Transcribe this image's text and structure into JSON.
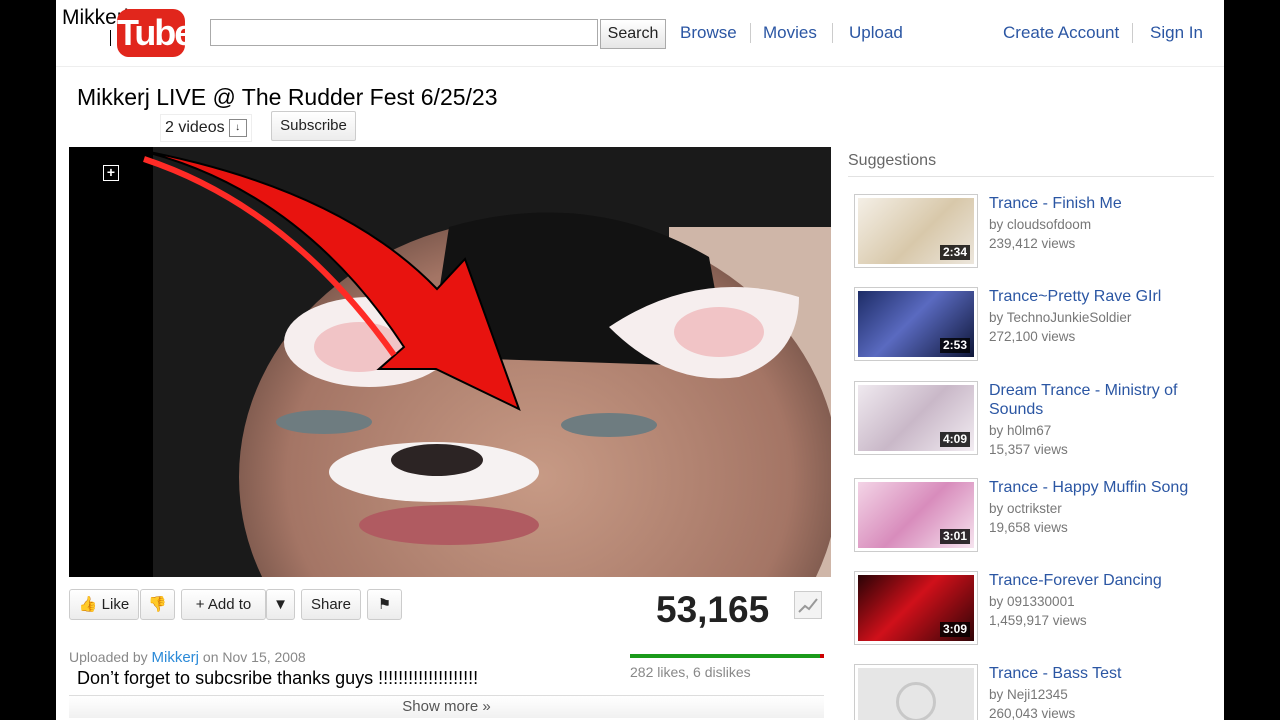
{
  "header": {
    "channel_text": "Mikkerj",
    "logo_text": "Tube",
    "search_value": "",
    "search_button": "Search",
    "nav": [
      "Browse",
      "Movies",
      "Upload"
    ],
    "account": [
      "Create Account",
      "Sign In"
    ]
  },
  "video": {
    "title": "Mikkerj LIVE @ The Rudder Fest 6/25/23",
    "videos_count": "2 videos",
    "subscribe_label": "Subscribe",
    "like_label": "Like",
    "add_to_label": "Add to",
    "share_label": "Share",
    "view_count": "53,165",
    "uploaded_prefix": "Uploaded by",
    "uploader": "Mikkerj",
    "upload_date": "on Nov 15, 2008",
    "likes_text": "282 likes, 6 dislikes",
    "likes": 282,
    "dislikes": 6,
    "description": "Don’t forget to subcsribe thanks guys !!!!!!!!!!!!!!!!!!!!",
    "show_more": "Show more"
  },
  "sidebar": {
    "label": "Suggestions",
    "items": [
      {
        "title": "Trance - Finish Me",
        "by": "by cloudsofdoom",
        "views": "239,412 views",
        "duration": "2:34"
      },
      {
        "title": "Trance~Pretty Rave GIrl",
        "by": "by TechnoJunkieSoldier",
        "views": "272,100 views",
        "duration": "2:53"
      },
      {
        "title": "Dream Trance - Ministry of Sounds",
        "by": "by h0lm67",
        "views": "15,357 views",
        "duration": "4:09"
      },
      {
        "title": "Trance - Happy Muffin Song",
        "by": "by octrikster",
        "views": "19,658 views",
        "duration": "3:01"
      },
      {
        "title": "Trance-Forever Dancing",
        "by": "by 091330001",
        "views": "1,459,917 views",
        "duration": "3:09"
      },
      {
        "title": "Trance - Bass Test",
        "by": "by Neji12345",
        "views": "260,043 views",
        "duration": ""
      }
    ]
  },
  "colors": {
    "link": "#2b56a3",
    "logo_red": "#e1261c",
    "likes_green": "#1a9a1a"
  }
}
